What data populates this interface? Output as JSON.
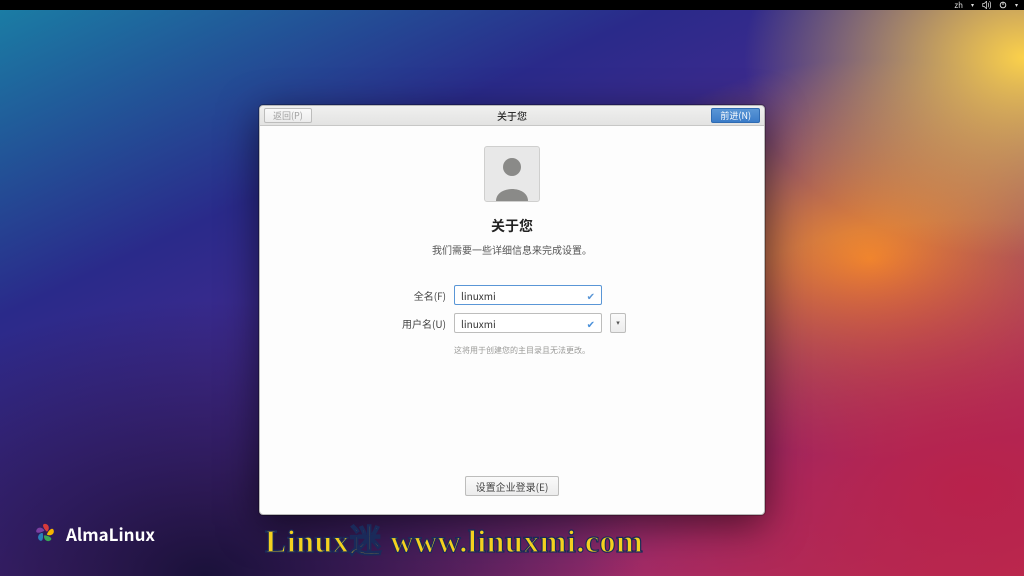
{
  "topbar": {
    "lang": "zh"
  },
  "dialog": {
    "header": {
      "back_label": "返回(P)",
      "title": "关于您",
      "next_label": "前进(N)"
    },
    "body": {
      "heading": "关于您",
      "subheading": "我们需要一些详细信息来完成设置。",
      "fullname_label": "全名(F)",
      "fullname_value": "linuxmi",
      "username_label": "用户名(U)",
      "username_value": "linuxmi",
      "hint": "这将用于创建您的主目录且无法更改。",
      "enterprise_label": "设置企业登录(E)"
    }
  },
  "brand": {
    "text": "AlmaLinux"
  },
  "watermark": {
    "text": "Linux迷 www.linuxmi.com"
  }
}
